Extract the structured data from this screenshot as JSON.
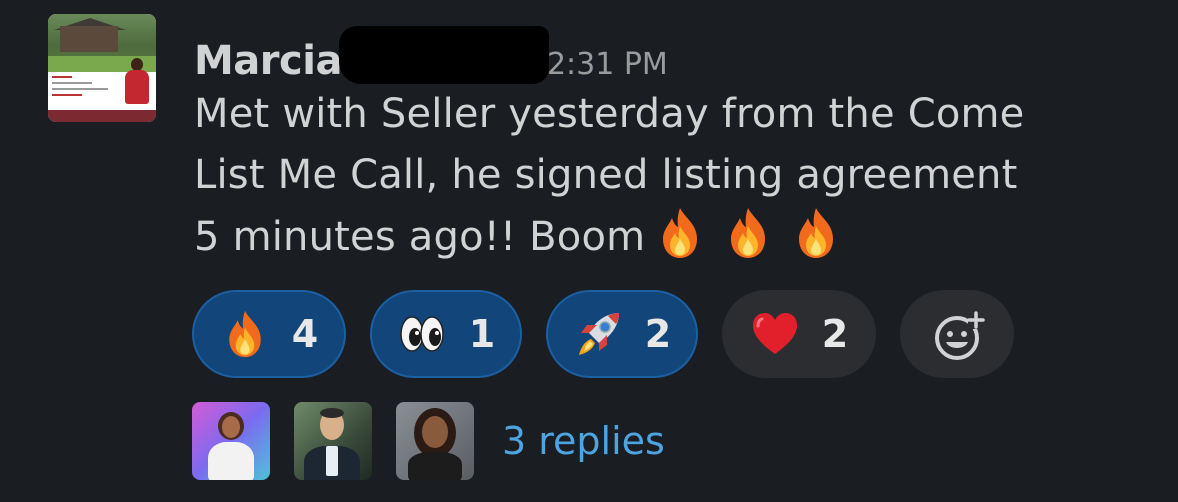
{
  "message": {
    "sender": "Marcia",
    "timestamp": "2:31 PM",
    "text_line1": "Met with Seller yesterday from the Come",
    "text_line2": "List Me Call, he signed listing agreement",
    "text_line3": "5 minutes ago!! Boom",
    "trailing_emojis": [
      "fire-emoji",
      "fire-emoji",
      "fire-emoji"
    ]
  },
  "reactions": [
    {
      "emoji": "fire-emoji",
      "count": "4",
      "reacted": true
    },
    {
      "emoji": "eyes-emoji",
      "count": "1",
      "reacted": true
    },
    {
      "emoji": "rocket-emoji",
      "count": "2",
      "reacted": true
    },
    {
      "emoji": "heart-emoji",
      "count": "2",
      "reacted": false
    },
    {
      "emoji": "add-reaction-icon",
      "count": null,
      "reacted": false
    }
  ],
  "thread": {
    "replies_label": "3 replies",
    "participant_count": 3
  },
  "colors": {
    "background": "#1a1d21",
    "text": "#d1d2d3",
    "timestamp": "#9a9b9d",
    "reaction_active_bg": "#12457a",
    "reaction_active_border": "#1d5fa3",
    "reaction_inactive_bg": "#2c2d30",
    "link": "#4da4e0"
  }
}
